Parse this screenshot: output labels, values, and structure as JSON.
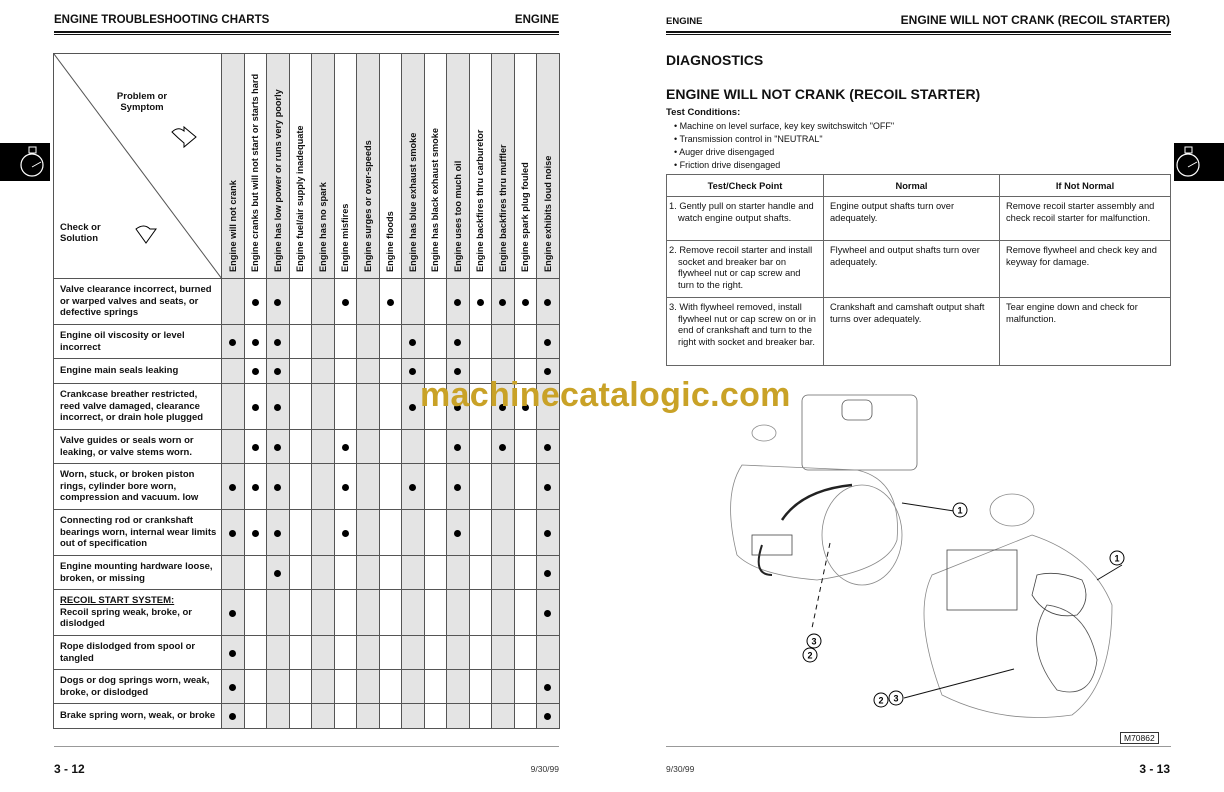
{
  "left_page": {
    "header_title": "ENGINE TROUBLESHOOTING CHARTS",
    "header_section": "ENGINE",
    "corner_top_label": "Problem or Symptom",
    "corner_bottom_label": "Check or Solution",
    "columns": [
      "Engine will not crank",
      "Engine cranks but will not start or starts hard",
      "Engine has low power or runs very poorly",
      "Engine fuel/air supply inadequate",
      "Engine has no spark",
      "Engine misfires",
      "Engine surges or over-speeds",
      "Engine floods",
      "Engine has blue exhaust smoke",
      "Engine has black exhaust smoke",
      "Engine uses too much oil",
      "Engine backfires thru carburetor",
      "Engine backfires thru muffler",
      "Engine spark plug fouled",
      "Engine exhibits loud noise"
    ],
    "rows": [
      {
        "label": "Valve clearance incorrect, burned or warped valves and seats, or defective springs",
        "marks": [
          1,
          2,
          5,
          7,
          10,
          11,
          12,
          13,
          14
        ]
      },
      {
        "label": "Engine oil viscosity or level incorrect",
        "marks": [
          0,
          1,
          2,
          8,
          10,
          14
        ]
      },
      {
        "label": "Engine main seals leaking",
        "marks": [
          1,
          2,
          8,
          10,
          14
        ]
      },
      {
        "label": "Crankcase breather restricted, reed valve damaged, clearance incorrect, or drain hole plugged",
        "marks": [
          1,
          2,
          8,
          10,
          12,
          13
        ]
      },
      {
        "label": "Valve guides or seals worn or leaking, or valve stems worn.",
        "marks": [
          1,
          2,
          5,
          10,
          12,
          14
        ]
      },
      {
        "label": "Worn, stuck, or broken piston rings, cylinder bore worn, compression and vacuum. low",
        "marks": [
          0,
          1,
          2,
          5,
          8,
          10,
          14
        ]
      },
      {
        "label": "Connecting rod or crankshaft bearings worn, internal wear limits out of specification",
        "marks": [
          0,
          1,
          2,
          5,
          10,
          14
        ]
      },
      {
        "label": "Engine mounting hardware loose, broken, or missing",
        "marks": [
          2,
          14
        ]
      },
      {
        "heading": "RECOIL START SYSTEM:",
        "label": "Recoil spring weak, broke, or dislodged",
        "marks": [
          0,
          14
        ]
      },
      {
        "label": "Rope dislodged from spool or tangled",
        "marks": [
          0
        ]
      },
      {
        "label": "Dogs or dog springs worn, weak, broke, or dislodged",
        "marks": [
          0,
          14
        ]
      },
      {
        "label": "Brake spring worn, weak, or broke",
        "marks": [
          0,
          14
        ]
      }
    ],
    "footer_page": "3 - 12",
    "footer_date": "9/30/99"
  },
  "right_page": {
    "header_section": "ENGINE",
    "header_title": "ENGINE WILL NOT CRANK (RECOIL STARTER)",
    "diagnostics_heading": "DIAGNOSTICS",
    "section_title": "ENGINE WILL NOT CRANK (RECOIL STARTER)",
    "test_conditions_label": "Test Conditions:",
    "test_conditions": [
      "Machine on level surface, key key switchswitch \"OFF\"",
      "Transmission control in \"NEUTRAL\"",
      "Auger drive disengaged",
      "Friction drive disengaged"
    ],
    "table_headers": [
      "Test/Check Point",
      "Normal",
      "If Not Normal"
    ],
    "table_rows": [
      [
        "1. Gently pull on starter handle and watch engine output shafts.",
        "Engine output shafts turn over adequately.",
        "Remove recoil starter assembly and check recoil starter for malfunction."
      ],
      [
        "2. Remove recoil starter and install socket and breaker bar on flywheel nut or cap screw and turn to the right.",
        "Flywheel and output shafts turn over adequately.",
        "Remove flywheel and check key and keyway for damage."
      ],
      [
        "3. With flywheel removed, install flywheel nut or cap screw on or in end of crankshaft and turn to the right with socket and breaker bar.",
        "Crankshaft and camshaft output shaft turns over adequately.",
        "Tear engine down and check for malfunction."
      ]
    ],
    "callouts": [
      "1",
      "1",
      "3",
      "2",
      "2",
      "3"
    ],
    "figure_id": "M70862",
    "footer_date": "9/30/99",
    "footer_page": "3 - 13"
  },
  "side_tab_icon": "engine-stopwatch-icon",
  "watermark": "machinecatalogic.com"
}
